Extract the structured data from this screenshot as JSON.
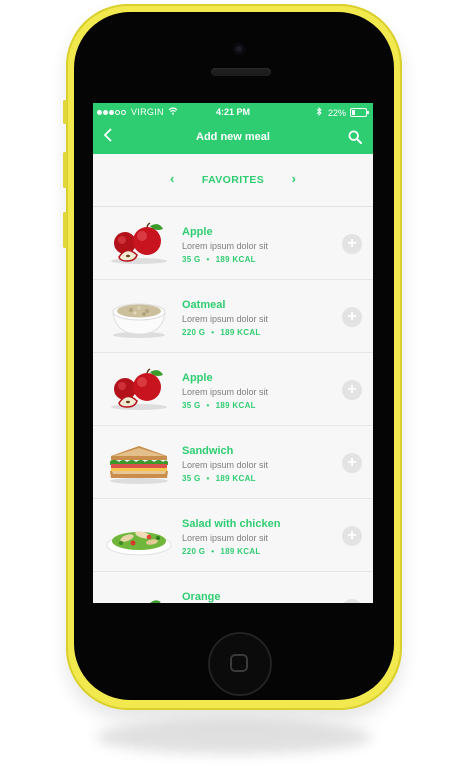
{
  "status_bar": {
    "carrier": "VIRGIN",
    "time": "4:21 PM",
    "battery_percent": "22%",
    "battery_level": 0.22,
    "signal_bars_filled": 3,
    "signal_bars_total": 5
  },
  "nav": {
    "title": "Add new meal",
    "back_icon": "chevron-left-icon",
    "search_icon": "search-icon"
  },
  "section": {
    "title": "FAVORITES"
  },
  "meals": [
    {
      "name": "Apple",
      "description": "Lorem ipsum dolor sit",
      "weight": "35 G",
      "kcal": "189 KCAL",
      "image": "apple"
    },
    {
      "name": "Oatmeal",
      "description": "Lorem ipsum dolor sit",
      "weight": "220 G",
      "kcal": "189 KCAL",
      "image": "oatmeal"
    },
    {
      "name": "Apple",
      "description": "Lorem ipsum dolor sit",
      "weight": "35 G",
      "kcal": "189 KCAL",
      "image": "apple"
    },
    {
      "name": "Sandwich",
      "description": "Lorem ipsum dolor sit",
      "weight": "35 G",
      "kcal": "189 KCAL",
      "image": "sandwich"
    },
    {
      "name": "Salad with chicken",
      "description": "Lorem ipsum dolor sit",
      "weight": "220 G",
      "kcal": "189 KCAL",
      "image": "salad"
    },
    {
      "name": "Orange",
      "description": "",
      "weight": "",
      "kcal": "",
      "image": "orange"
    }
  ],
  "colors": {
    "accent": "#2fcd72",
    "phone_body": "#f2e94e",
    "text_muted": "#7d7d7d",
    "add_button": "#e3e3e3"
  }
}
